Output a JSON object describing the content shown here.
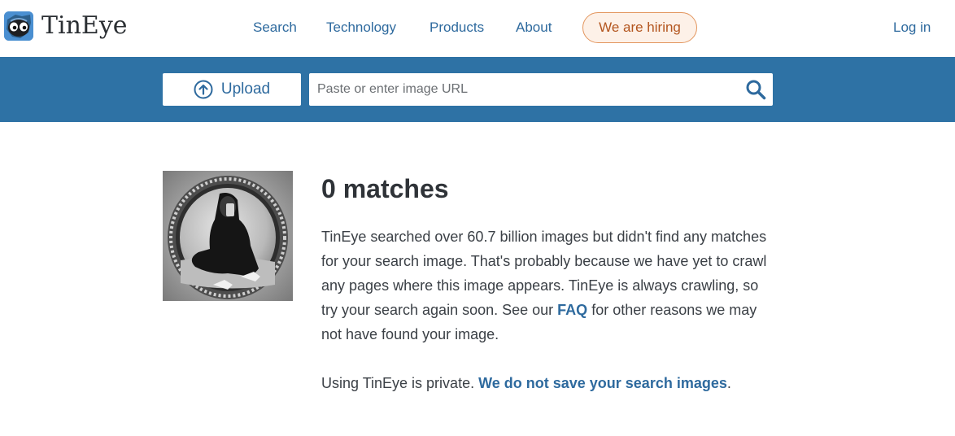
{
  "brand": {
    "name": "TinEye"
  },
  "nav": {
    "search": "Search",
    "technology": "Technology",
    "products": "Products",
    "about": "About",
    "hiring": "We are hiring",
    "login": "Log in"
  },
  "search_bar": {
    "upload_label": "Upload",
    "url_placeholder": "Paste or enter image URL",
    "url_value": ""
  },
  "result": {
    "title": "0 matches",
    "para1_text": "TinEye searched over 60.7 billion images but didn't find any matches for your search image. That's probably because we have yet to crawl any pages where this image appears. TinEye is always crawling, so try your search again soon. See our ",
    "faq_link": "FAQ",
    "para1_tail": " for other reasons we may not have found your image.",
    "privacy_text": "Using TinEye is private. ",
    "privacy_link": "We do not save your search images",
    "privacy_tail": "."
  },
  "colors": {
    "band": "#2e72a5",
    "link": "#2e6a9e",
    "hiring_border": "#e3965e",
    "hiring_text": "#b3551e"
  }
}
